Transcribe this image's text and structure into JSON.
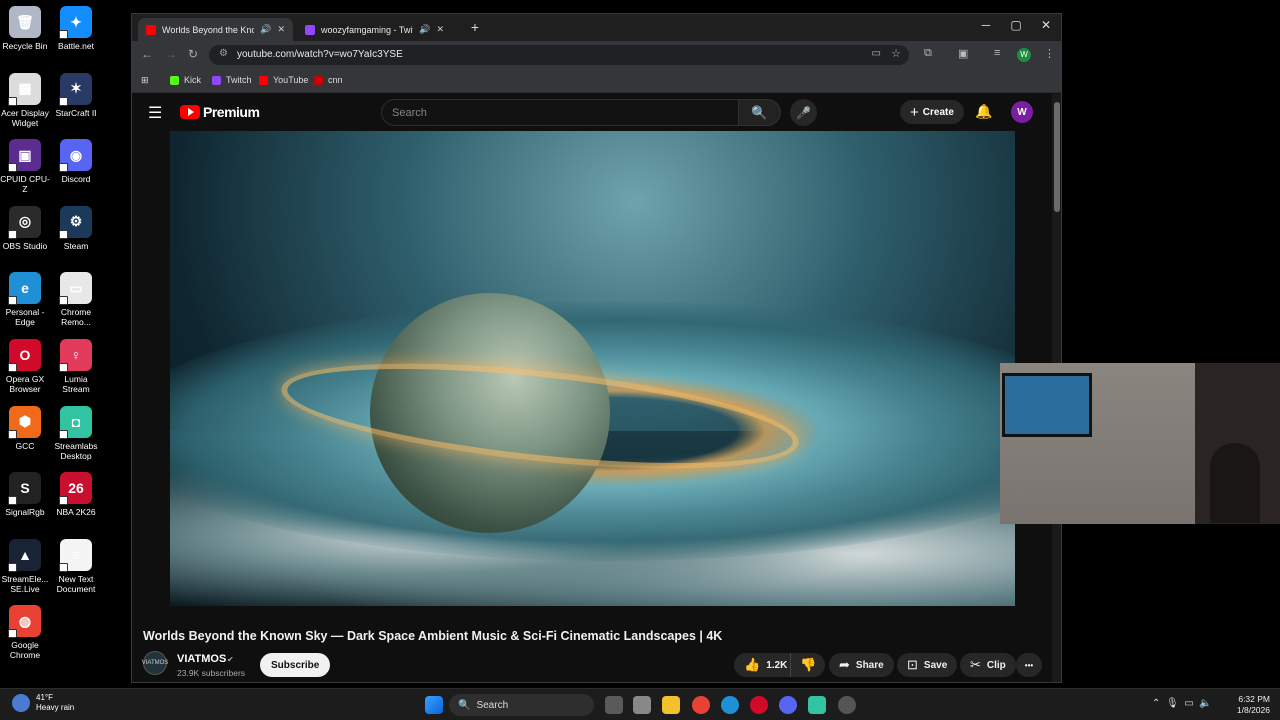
{
  "desktop": {
    "icons": [
      {
        "label": "Recycle Bin",
        "color": "#b0b8c8",
        "glyph": "🗑"
      },
      {
        "label": "Battle.net",
        "color": "#148eff",
        "glyph": "✦"
      },
      {
        "label": "Acer Display Widget",
        "color": "#dcdcdc",
        "glyph": "▦"
      },
      {
        "label": "StarCraft II",
        "color": "#2a3a66",
        "glyph": "✶"
      },
      {
        "label": "CPUID CPU-Z",
        "color": "#5b2d8e",
        "glyph": "▣"
      },
      {
        "label": "Discord",
        "color": "#5865f2",
        "glyph": "◉"
      },
      {
        "label": "OBS Studio",
        "color": "#2b2b2b",
        "glyph": "◎"
      },
      {
        "label": "Steam",
        "color": "#1b3a5a",
        "glyph": "⚙"
      },
      {
        "label": "Personal - Edge",
        "color": "#1f8fd6",
        "glyph": "e"
      },
      {
        "label": "Chrome Remo...",
        "color": "#e8e8e8",
        "glyph": "▭"
      },
      {
        "label": "Opera GX Browser",
        "color": "#d10a2a",
        "glyph": "O"
      },
      {
        "label": "Lumia Stream",
        "color": "#e23a5a",
        "glyph": "♀"
      },
      {
        "label": "GCC",
        "color": "#f06a1a",
        "glyph": "⬢"
      },
      {
        "label": "Streamlabs Desktop",
        "color": "#31c3a2",
        "glyph": "◘"
      },
      {
        "label": "SignalRgb",
        "color": "#222222",
        "glyph": "S"
      },
      {
        "label": "NBA 2K26",
        "color": "#c8102e",
        "glyph": "26"
      },
      {
        "label": "StreamEle... SE.Live",
        "color": "#1a2333",
        "glyph": "▲"
      },
      {
        "label": "New Text Document",
        "color": "#f4f4f4",
        "glyph": "≡"
      },
      {
        "label": "Google Chrome",
        "color": "#e94235",
        "glyph": "◍"
      }
    ]
  },
  "browser": {
    "tabs": [
      {
        "title": "Worlds Beyond the Known",
        "active": true,
        "favicon_color": "#ff0000"
      },
      {
        "title": "woozyfamgaming - Twitch",
        "active": false,
        "favicon_color": "#9146ff"
      }
    ],
    "new_tab_label": "+",
    "url": "youtube.com/watch?v=wo7YaIc3YSE",
    "bookmarks": [
      {
        "label": "Kick",
        "color": "#53fc18"
      },
      {
        "label": "Twitch",
        "color": "#9146ff"
      },
      {
        "label": "YouTube",
        "color": "#ff0000"
      },
      {
        "label": "cnn",
        "color": "#cc0000"
      }
    ],
    "profile_initial": "W"
  },
  "youtube": {
    "logo_text": "Premium",
    "search_placeholder": "Search",
    "create_label": "Create",
    "avatar_initial": "W",
    "video_title": "Worlds Beyond the Known Sky — Dark Space Ambient Music & Sci-Fi Cinematic Landscapes | 4K",
    "channel_name": "VIATMOS",
    "channel_avatar_text": "VIATMOS",
    "subscribers": "23.9K subscribers",
    "subscribe_label": "Subscribe",
    "likes": "1.2K",
    "share_label": "Share",
    "save_label": "Save",
    "clip_label": "Clip",
    "more_label": "•••"
  },
  "taskbar": {
    "weather_temp": "41°F",
    "weather_desc": "Heavy rain",
    "search_label": "Search",
    "time": "6:32 PM",
    "date": "1/8/2026"
  }
}
